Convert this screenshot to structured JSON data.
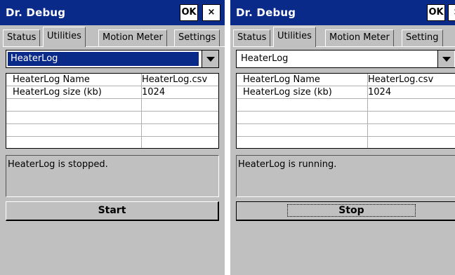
{
  "screens": [
    {
      "title": "Dr. Debug",
      "ok_label": "OK",
      "close_label": "×",
      "tabs": [
        "Status",
        "Utilities",
        "Motion Meter",
        "Settings"
      ],
      "active_tab": "Utilities",
      "dropdown_value": "HeaterLog",
      "dropdown_selected": true,
      "table_rows": [
        {
          "name": "HeaterLog Name",
          "value": "HeaterLog.csv"
        },
        {
          "name": "HeaterLog size (kb)",
          "value": "1024"
        }
      ],
      "status_message": "HeaterLog is stopped.",
      "action_button_label": "Start"
    },
    {
      "title": "Dr. Debug",
      "ok_label": "OK",
      "close_label": "×",
      "tabs": [
        "Status",
        "Utilities",
        "Motion Meter",
        "Setting"
      ],
      "active_tab": "Utilities",
      "dropdown_value": "HeaterLog",
      "dropdown_selected": false,
      "table_rows": [
        {
          "name": "HeaterLog Name",
          "value": "HeaterLog.csv"
        },
        {
          "name": "HeaterLog size (kb)",
          "value": "1024"
        }
      ],
      "status_message": "HeaterLog is running.",
      "action_button_label": "Stop"
    }
  ],
  "colors": {
    "titlebar": "#0a2a8a",
    "window_bg": "#c0c0c0",
    "selection": "#0a2a8a"
  }
}
